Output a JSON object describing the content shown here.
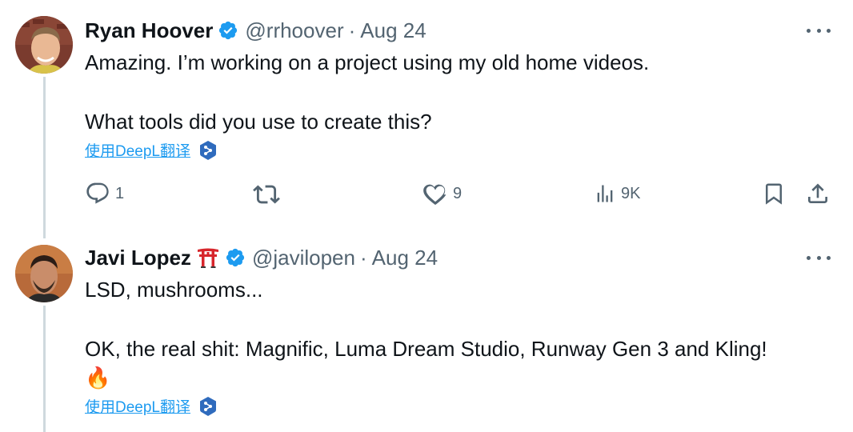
{
  "tweets": [
    {
      "name": "Ryan Hoover",
      "handle": "@rrhoover",
      "separator": "·",
      "date": "Aug 24",
      "text_line1": "Amazing. I’m working on a project using my old home videos.",
      "text_line2": "What tools did you use to create this?",
      "translate_label": "使用DeepL翻译",
      "actions": {
        "reply_count": "1",
        "retweet_count": "",
        "like_count": "9",
        "views_count": "9K"
      }
    },
    {
      "name": "Javi Lopez",
      "handle": "@javilopen",
      "separator": "·",
      "date": "Aug 24",
      "text_line1": "LSD, mushrooms...",
      "text_line2": "OK, the real shit: Magnific, Luma Dream Studio, Runway Gen 3 and Kling!",
      "emoji": "🔥",
      "translate_label": "使用DeepL翻译"
    }
  ],
  "icons": {
    "verified": "verified-badge-icon",
    "more": "more-icon",
    "reply": "reply-icon",
    "retweet": "retweet-icon",
    "like": "like-icon",
    "views": "views-icon",
    "bookmark": "bookmark-icon",
    "share": "share-icon",
    "deepl": "deepl-icon",
    "torii": "torii-gate-icon"
  },
  "colors": {
    "verified_blue": "#1d9bf0",
    "link_blue": "#1d9bf0",
    "muted": "#536471",
    "thread_line": "#cfd9de",
    "deepl_blue": "#0f2b46"
  }
}
